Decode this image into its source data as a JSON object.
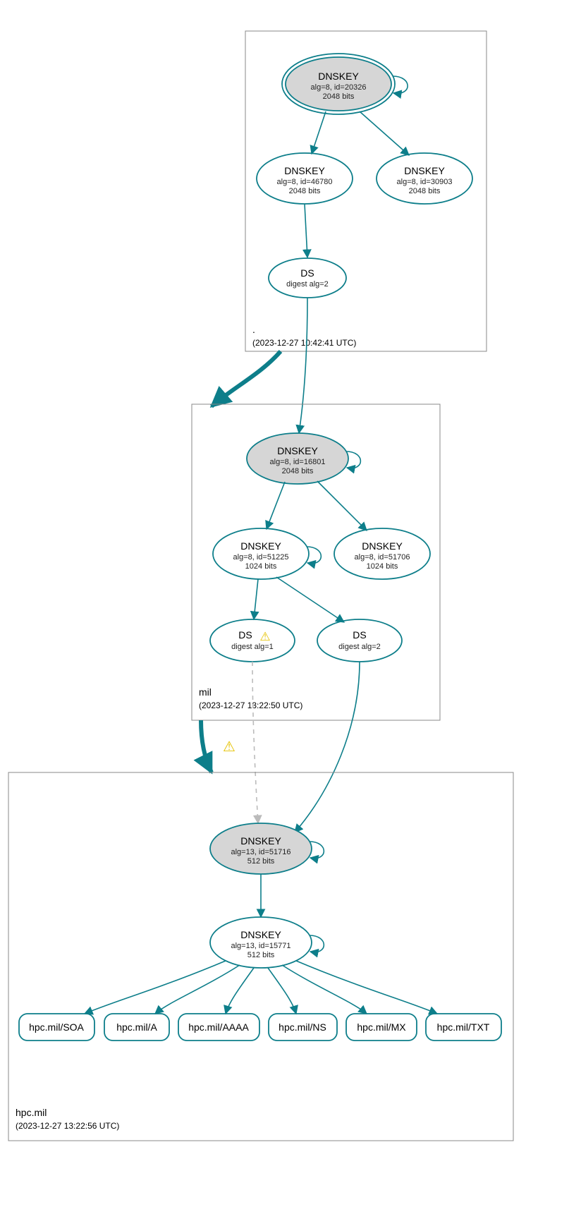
{
  "zones": {
    "root": {
      "label": ".",
      "time": "(2023-12-27 10:42:41 UTC)"
    },
    "mil": {
      "label": "mil",
      "time": "(2023-12-27 13:22:50 UTC)"
    },
    "hpc": {
      "label": "hpc.mil",
      "time": "(2023-12-27 13:22:56 UTC)"
    }
  },
  "nodes": {
    "root_ksk": {
      "t": "DNSKEY",
      "l1": "alg=8, id=20326",
      "l2": "2048 bits"
    },
    "root_zsk1": {
      "t": "DNSKEY",
      "l1": "alg=8, id=46780",
      "l2": "2048 bits"
    },
    "root_zsk2": {
      "t": "DNSKEY",
      "l1": "alg=8, id=30903",
      "l2": "2048 bits"
    },
    "root_ds": {
      "t": "DS",
      "l1": "digest alg=2"
    },
    "mil_ksk": {
      "t": "DNSKEY",
      "l1": "alg=8, id=16801",
      "l2": "2048 bits"
    },
    "mil_zsk1": {
      "t": "DNSKEY",
      "l1": "alg=8, id=51225",
      "l2": "1024 bits"
    },
    "mil_zsk2": {
      "t": "DNSKEY",
      "l1": "alg=8, id=51706",
      "l2": "1024 bits"
    },
    "mil_ds1": {
      "t": "DS",
      "l1": "digest alg=1"
    },
    "mil_ds2": {
      "t": "DS",
      "l1": "digest alg=2"
    },
    "hpc_ksk": {
      "t": "DNSKEY",
      "l1": "alg=13, id=51716",
      "l2": "512 bits"
    },
    "hpc_zsk": {
      "t": "DNSKEY",
      "l1": "alg=13, id=15771",
      "l2": "512 bits"
    }
  },
  "rr": {
    "soa": "hpc.mil/SOA",
    "a": "hpc.mil/A",
    "aaaa": "hpc.mil/AAAA",
    "ns": "hpc.mil/NS",
    "mx": "hpc.mil/MX",
    "txt": "hpc.mil/TXT"
  },
  "icons": {
    "warn": "⚠"
  }
}
